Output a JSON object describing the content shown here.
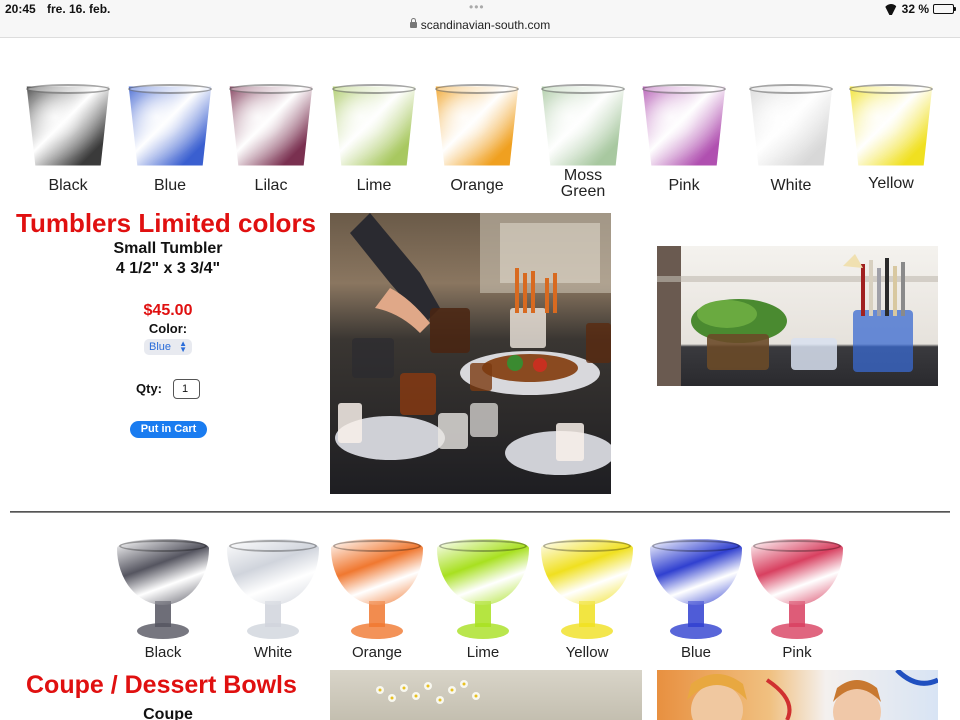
{
  "status_bar": {
    "time": "20:45",
    "date": "fre. 16. feb.",
    "url": "scandinavian-south.com",
    "battery": "32 %",
    "battery_level": 0.32
  },
  "tumblers": {
    "swatches": [
      {
        "label": "Black",
        "color": "#3a3a3a"
      },
      {
        "label": "Blue",
        "color": "#3a5fd0"
      },
      {
        "label": "Lilac",
        "color": "#7a3050"
      },
      {
        "label": "Lime",
        "color": "#a8c860"
      },
      {
        "label": "Orange",
        "color": "#f0a020"
      },
      {
        "label": "Moss Green",
        "label_line1": "Moss",
        "label_line2": "Green",
        "color": "#a8c8a0"
      },
      {
        "label": "Pink",
        "color": "#b050b0"
      },
      {
        "label": "White",
        "color": "#d8d8d8"
      },
      {
        "label": "Yellow",
        "color": "#f0e020"
      }
    ],
    "title": "Tumblers Limited colors",
    "product_name": "Small Tumbler",
    "dimensions": "4 1/2\" x 3 3/4\"",
    "price": "$45.00",
    "color_label": "Color:",
    "color_selected": "Blue",
    "qty_label": "Qty:",
    "qty_value": "1",
    "cart_button": "Put in Cart"
  },
  "bowls": {
    "swatches": [
      {
        "label": "Black",
        "color": "#555560"
      },
      {
        "label": "White",
        "color": "#d0d4dc"
      },
      {
        "label": "Orange",
        "color": "#f07830"
      },
      {
        "label": "Lime",
        "color": "#a8e020"
      },
      {
        "label": "Yellow",
        "color": "#f0e020"
      },
      {
        "label": "Blue",
        "color": "#3040d0"
      },
      {
        "label": "Pink",
        "color": "#d84060"
      }
    ],
    "title": "Coupe / Dessert Bowls",
    "product_name": "Coupe"
  }
}
